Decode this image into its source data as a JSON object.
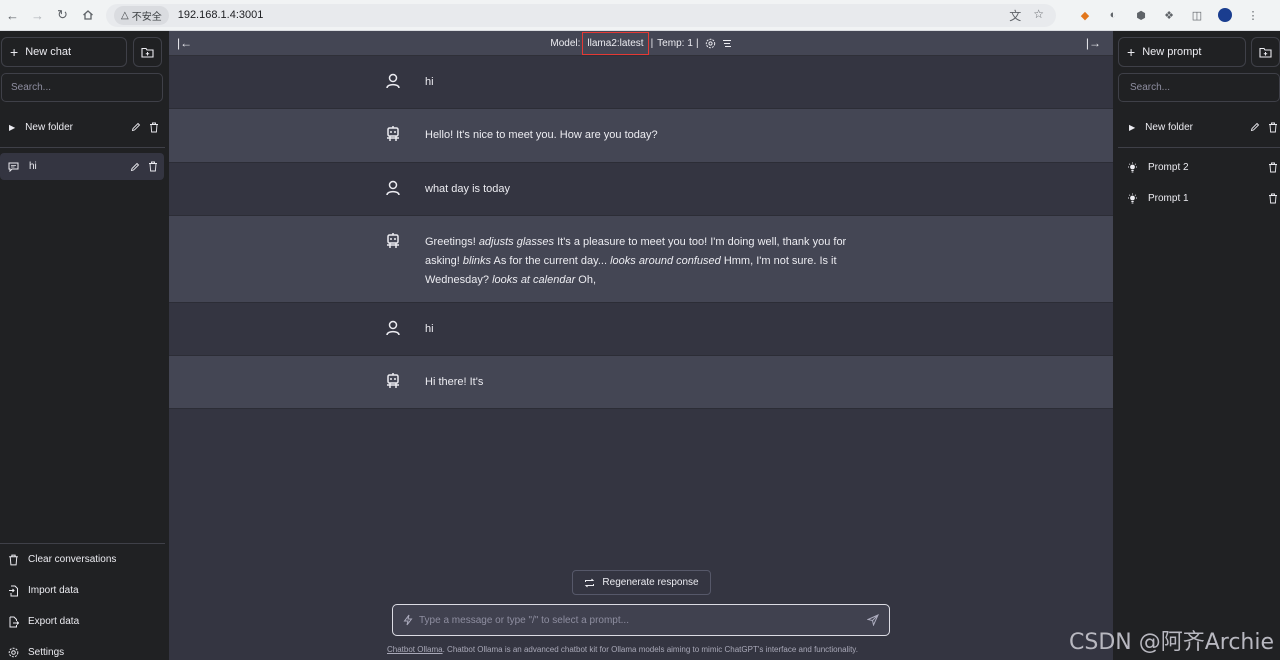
{
  "browser": {
    "security_label": "不安全",
    "url": "192.168.1.4:3001"
  },
  "left_sidebar": {
    "new_chat": "New chat",
    "search_placeholder": "Search...",
    "folder_name": "New folder",
    "conversations": [
      {
        "label": "hi"
      }
    ],
    "bottom_menu": {
      "clear": "Clear conversations",
      "import": "Import data",
      "export": "Export data",
      "settings": "Settings"
    }
  },
  "header": {
    "model_label": "Model:",
    "model_value": "llama2:latest",
    "sep1": "|",
    "temp_label": "Temp:",
    "temp_value": "1",
    "sep2": "|"
  },
  "messages": [
    {
      "role": "user",
      "text": "hi"
    },
    {
      "role": "assistant",
      "text": "Hello! It's nice to meet you. How are you today?"
    },
    {
      "role": "user",
      "text": "what day is today"
    },
    {
      "role": "assistant",
      "segments": [
        {
          "t": "Greetings! ",
          "i": false
        },
        {
          "t": "adjusts glasses",
          "i": true
        },
        {
          "t": " It's a pleasure to meet you too! I'm doing well, thank you for asking! ",
          "i": false
        },
        {
          "t": "blinks",
          "i": true
        },
        {
          "t": " As for the current day... ",
          "i": false
        },
        {
          "t": "looks around confused",
          "i": true
        },
        {
          "t": " Hmm, I'm not sure. Is it Wednesday? ",
          "i": false
        },
        {
          "t": "looks at calendar",
          "i": true
        },
        {
          "t": " Oh,",
          "i": false
        }
      ]
    },
    {
      "role": "user",
      "text": "hi"
    },
    {
      "role": "assistant",
      "text": "Hi there! It's"
    }
  ],
  "composer": {
    "regenerate": "Regenerate response",
    "placeholder": "Type a message or type \"/\" to select a prompt..."
  },
  "footer": {
    "link_text": "Chatbot Ollama",
    "description": ". Chatbot Ollama is an advanced chatbot kit for Ollama models aiming to mimic ChatGPT's interface and functionality."
  },
  "right_sidebar": {
    "new_prompt": "New prompt",
    "search_placeholder": "Search...",
    "folder_name": "New folder",
    "prompts": [
      {
        "label": "Prompt 2"
      },
      {
        "label": "Prompt 1"
      }
    ]
  },
  "watermark": "CSDN @阿齐Archie",
  "colors": {
    "sidebar_bg": "#202123",
    "main_bg": "#343541",
    "assistant_row_bg": "#444654",
    "annotation_red": "#e53935"
  }
}
